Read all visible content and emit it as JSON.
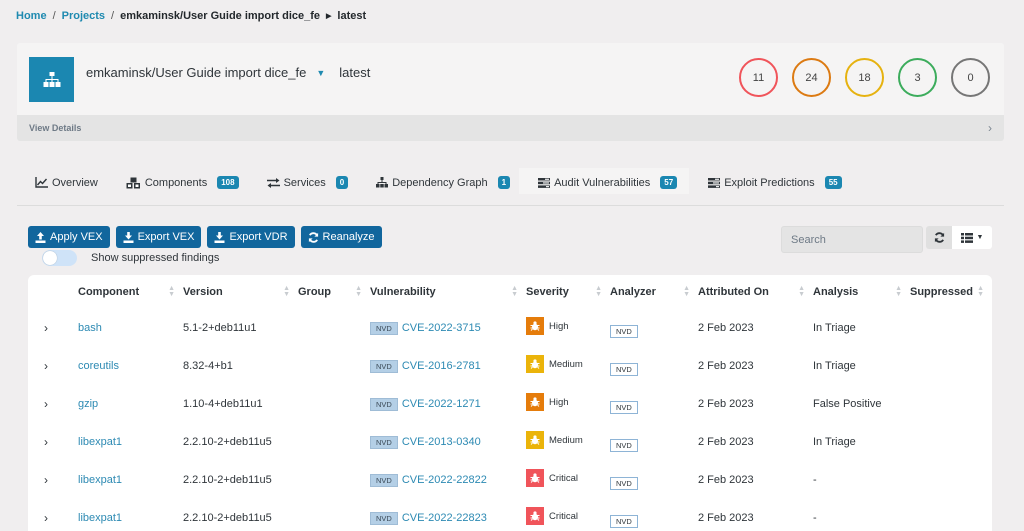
{
  "breadcrumb": {
    "home": "Home",
    "projects": "Projects",
    "project": "emkaminsk/User Guide import dice_fe",
    "version": "latest"
  },
  "project": {
    "name": "emkaminsk/User Guide import dice_fe",
    "version": "latest",
    "view_details": "View Details",
    "severity_counts": [
      {
        "label": "critical",
        "value": "11",
        "color": "#f0545a"
      },
      {
        "label": "high",
        "value": "24",
        "color": "#dc7a12"
      },
      {
        "label": "medium",
        "value": "18",
        "color": "#e6b210"
      },
      {
        "label": "low",
        "value": "3",
        "color": "#3cac5c"
      },
      {
        "label": "unassigned",
        "value": "0",
        "color": "#767676"
      }
    ]
  },
  "tabs": [
    {
      "label": "Overview",
      "icon": "line-chart-icon",
      "badge": null
    },
    {
      "label": "Components",
      "icon": "cubes-icon",
      "badge": "108"
    },
    {
      "label": "Services",
      "icon": "exchange-icon",
      "badge": "0"
    },
    {
      "label": "Dependency Graph",
      "icon": "sitemap-icon",
      "badge": "1"
    },
    {
      "label": "Audit Vulnerabilities",
      "icon": "tasks-icon",
      "badge": "57",
      "active": true
    },
    {
      "label": "Exploit Predictions",
      "icon": "tasks-icon",
      "badge": "55"
    }
  ],
  "toolbar": {
    "apply_vex": "Apply VEX",
    "export_vex": "Export VEX",
    "export_vdr": "Export VDR",
    "reanalyze": "Reanalyze",
    "show_suppressed": "Show suppressed findings",
    "show_suppressed_on": false,
    "search_placeholder": "Search"
  },
  "table": {
    "columns": [
      "Component",
      "Version",
      "Group",
      "Vulnerability",
      "Severity",
      "Analyzer",
      "Attributed On",
      "Analysis",
      "Suppressed"
    ],
    "rows": [
      {
        "component": "bash",
        "version": "5.1-2+deb11u1",
        "group": "",
        "source": "NVD",
        "vulnerability": "CVE-2022-3715",
        "severity": "High",
        "severity_color": "#e57c0b",
        "analyzer": "NVD",
        "attributed_on": "2 Feb 2023",
        "analysis": "In Triage",
        "suppressed": ""
      },
      {
        "component": "coreutils",
        "version": "8.32-4+b1",
        "group": "",
        "source": "NVD",
        "vulnerability": "CVE-2016-2781",
        "severity": "Medium",
        "severity_color": "#ebb40a",
        "analyzer": "NVD",
        "attributed_on": "2 Feb 2023",
        "analysis": "In Triage",
        "suppressed": ""
      },
      {
        "component": "gzip",
        "version": "1.10-4+deb11u1",
        "group": "",
        "source": "NVD",
        "vulnerability": "CVE-2022-1271",
        "severity": "High",
        "severity_color": "#e57c0b",
        "analyzer": "NVD",
        "attributed_on": "2 Feb 2023",
        "analysis": "False Positive",
        "suppressed": ""
      },
      {
        "component": "libexpat1",
        "version": "2.2.10-2+deb11u5",
        "group": "",
        "source": "NVD",
        "vulnerability": "CVE-2013-0340",
        "severity": "Medium",
        "severity_color": "#ebb40a",
        "analyzer": "NVD",
        "attributed_on": "2 Feb 2023",
        "analysis": "In Triage",
        "suppressed": ""
      },
      {
        "component": "libexpat1",
        "version": "2.2.10-2+deb11u5",
        "group": "",
        "source": "NVD",
        "vulnerability": "CVE-2022-22822",
        "severity": "Critical",
        "severity_color": "#f0545a",
        "analyzer": "NVD",
        "attributed_on": "2 Feb 2023",
        "analysis": "-",
        "suppressed": ""
      },
      {
        "component": "libexpat1",
        "version": "2.2.10-2+deb11u5",
        "group": "",
        "source": "NVD",
        "vulnerability": "CVE-2022-22823",
        "severity": "Critical",
        "severity_color": "#f0545a",
        "analyzer": "NVD",
        "attributed_on": "2 Feb 2023",
        "analysis": "-",
        "suppressed": ""
      }
    ]
  }
}
